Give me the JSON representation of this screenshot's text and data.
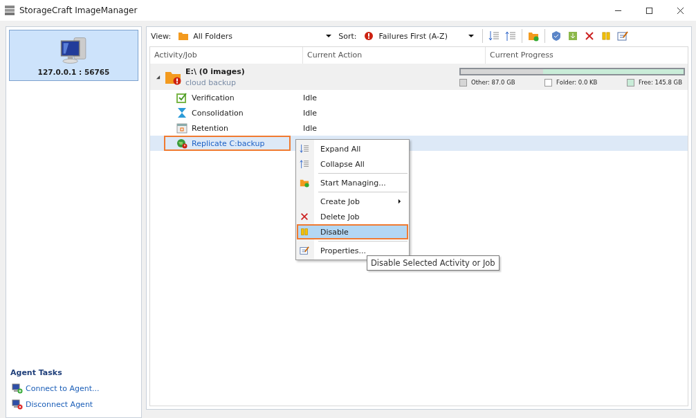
{
  "window": {
    "title": "StorageCraft ImageManager"
  },
  "sidebar": {
    "agent": {
      "label": "127.0.0.1 : 56765",
      "selected": true
    },
    "tasks_title": "Agent Tasks",
    "tasks": [
      {
        "label": "Connect to Agent...",
        "kind": "connect"
      },
      {
        "label": "Disconnect Agent",
        "kind": "disconnect"
      }
    ]
  },
  "toolbar": {
    "view_label": "View:",
    "view_value": "All Folders",
    "sort_label": "Sort:",
    "sort_value": "Failures First (A-Z)",
    "buttons": [
      {
        "kind": "expand"
      },
      {
        "kind": "collapse"
      },
      {
        "kind": "folder-add"
      },
      {
        "kind": "verify"
      },
      {
        "kind": "consolidate"
      },
      {
        "kind": "delete"
      },
      {
        "kind": "pause"
      },
      {
        "kind": "properties"
      }
    ]
  },
  "table": {
    "columns": [
      "Activity/Job",
      "Current Action",
      "Current Progress"
    ],
    "folder": {
      "name": "E:\\  (0 images)",
      "subtitle": "cloud backup",
      "expanded": true,
      "error": true,
      "storage": {
        "level": 0.37,
        "legend": [
          {
            "label": "Other: 87.0 GB",
            "color": "#d6d6d6"
          },
          {
            "label": "Folder: 0.0 KB",
            "color": "#ffffff"
          },
          {
            "label": "Free: 145.8 GB",
            "color": "#c9ecd8"
          }
        ]
      }
    },
    "jobs": [
      {
        "name": "Verification",
        "action": "Idle",
        "kind": "verification",
        "selected": false,
        "highlighted": false
      },
      {
        "name": "Consolidation",
        "action": "Idle",
        "kind": "consolidation",
        "selected": false,
        "highlighted": false
      },
      {
        "name": "Retention",
        "action": "Idle",
        "kind": "retention",
        "selected": false,
        "highlighted": false
      },
      {
        "name": "Replicate C:backup",
        "kind": "replicate",
        "selected": true,
        "highlighted": true
      }
    ]
  },
  "context_menu": {
    "groups": [
      [
        {
          "label": "Expand All",
          "kind": "expand",
          "submenu": false,
          "selected": false
        },
        {
          "label": "Collapse All",
          "kind": "collapse",
          "submenu": false,
          "selected": false
        }
      ],
      [
        {
          "label": "Start Managing...",
          "kind": "folder-add",
          "submenu": false,
          "selected": false
        }
      ],
      [
        {
          "label": "Create Job",
          "kind": "plain",
          "submenu": true,
          "selected": false
        },
        {
          "label": "Delete Job",
          "kind": "delete",
          "submenu": false,
          "selected": false
        },
        {
          "label": "Disable",
          "kind": "pause",
          "submenu": false,
          "selected": true
        }
      ],
      [
        {
          "label": "Properties...",
          "kind": "properties",
          "submenu": false,
          "selected": false
        }
      ]
    ]
  },
  "tooltip": "Disable Selected Activity or Job"
}
